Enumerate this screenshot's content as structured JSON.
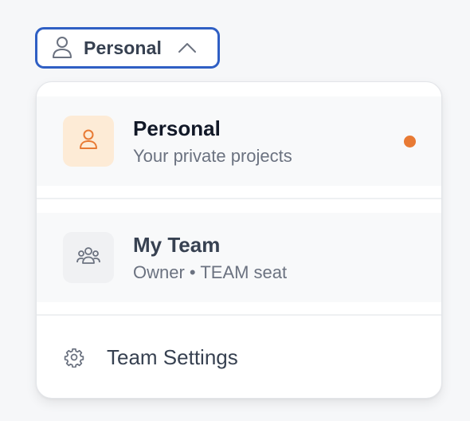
{
  "trigger": {
    "label": "Personal",
    "icon": "user-icon",
    "chevron": "chevron-up-icon",
    "border_color": "#2f5fc4"
  },
  "menu": {
    "items": [
      {
        "title": "Personal",
        "subtitle": "Your private projects",
        "icon": "user-icon",
        "icon_color": "#e87a34",
        "icon_bg": "#fdebd6",
        "selected": true,
        "indicator_color": "#e87a34"
      },
      {
        "title": "My Team",
        "subtitle": "Owner • TEAM seat",
        "icon": "users-icon",
        "icon_color": "#6b7280",
        "icon_bg": "#f0f1f3",
        "selected": false
      }
    ],
    "settings": {
      "label": "Team Settings",
      "icon": "gear-icon"
    }
  }
}
